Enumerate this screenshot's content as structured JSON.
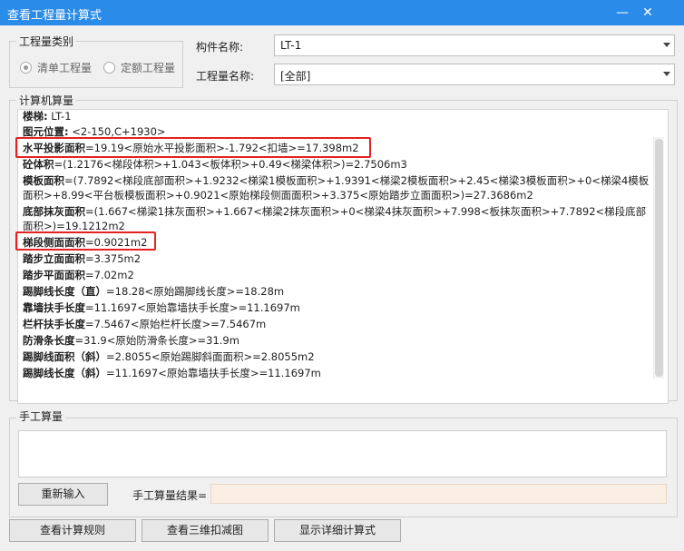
{
  "window": {
    "title": "查看工程量计算式",
    "minimize_glyph": "—",
    "close_glyph": "✕"
  },
  "quantity_category": {
    "group_label": "工程量类别",
    "options": [
      {
        "label": "清单工程量",
        "selected": true
      },
      {
        "label": "定额工程量",
        "selected": false
      }
    ]
  },
  "component": {
    "label": "构件名称:",
    "value": "LT-1"
  },
  "quantity_name": {
    "label": "工程量名称:",
    "value": "[全部]"
  },
  "computer_calc": {
    "group_label": "计算机算量",
    "lines": [
      {
        "name": "楼梯:",
        "value": " LT-1"
      },
      {
        "name": "图元位置:",
        "value": " <2-150,C+1930>"
      },
      {
        "name": "水平投影面积",
        "value": "=19.19<原始水平投影面积>-1.792<扣墙>=17.398m2"
      },
      {
        "name": "砼体积",
        "value": "=(1.2176<梯段体积>+1.043<板体积>+0.49<梯梁体积>)=2.7506m3"
      },
      {
        "name": "模板面积",
        "value": "=(7.7892<梯段底部面积>+1.9232<梯梁1模板面积>+1.9391<梯梁2模板面积>+2.45<梯梁3模板面积>+0<梯梁4模板"
      },
      {
        "name": "",
        "value": "面积>+8.99<平台板模板面积>+0.9021<原始梯段侧面面积>+3.375<原始踏步立面面积>)=27.3686m2"
      },
      {
        "name": "底部抹灰面积",
        "value": "=(1.667<梯梁1抹灰面积>+1.667<梯梁2抹灰面积>+0<梯梁4抹灰面积>+7.998<板抹灰面积>+7.7892<梯段底部"
      },
      {
        "name": "",
        "value": "面积>)=19.1212m2"
      },
      {
        "name": "梯段侧面面积",
        "value": "=0.9021m2"
      },
      {
        "name": "踏步立面面积",
        "value": "=3.375m2"
      },
      {
        "name": "踏步平面面积",
        "value": "=7.02m2"
      },
      {
        "name": "踢脚线长度（直）",
        "value": "=18.28<原始踢脚线长度>=18.28m"
      },
      {
        "name": "靠墙扶手长度",
        "value": "=11.1697<原始靠墙扶手长度>=11.1697m"
      },
      {
        "name": "栏杆扶手长度",
        "value": "=7.5467<原始栏杆长度>=7.5467m"
      },
      {
        "name": "防滑条长度",
        "value": "=31.9<原始防滑条长度>=31.9m"
      },
      {
        "name": "踢脚线面积（斜）",
        "value": "=2.8055<原始踢脚斜面面积>=2.8055m2"
      },
      {
        "name": "踢脚线长度（斜）",
        "value": "=11.1697<原始靠墙扶手长度>=11.1697m"
      }
    ]
  },
  "manual_calc": {
    "group_label": "手工算量",
    "reenter_label": "重新输入",
    "result_label": "手工算量结果=",
    "result_value": ""
  },
  "bottom_buttons": {
    "view_rules": "查看计算规则",
    "view_3d": "查看三维扣减图",
    "show_detail": "显示详细计算式"
  },
  "colors": {
    "titlebar": "#2b8be8",
    "highlight_border": "#e52121",
    "result_field": "#fbefe3"
  }
}
